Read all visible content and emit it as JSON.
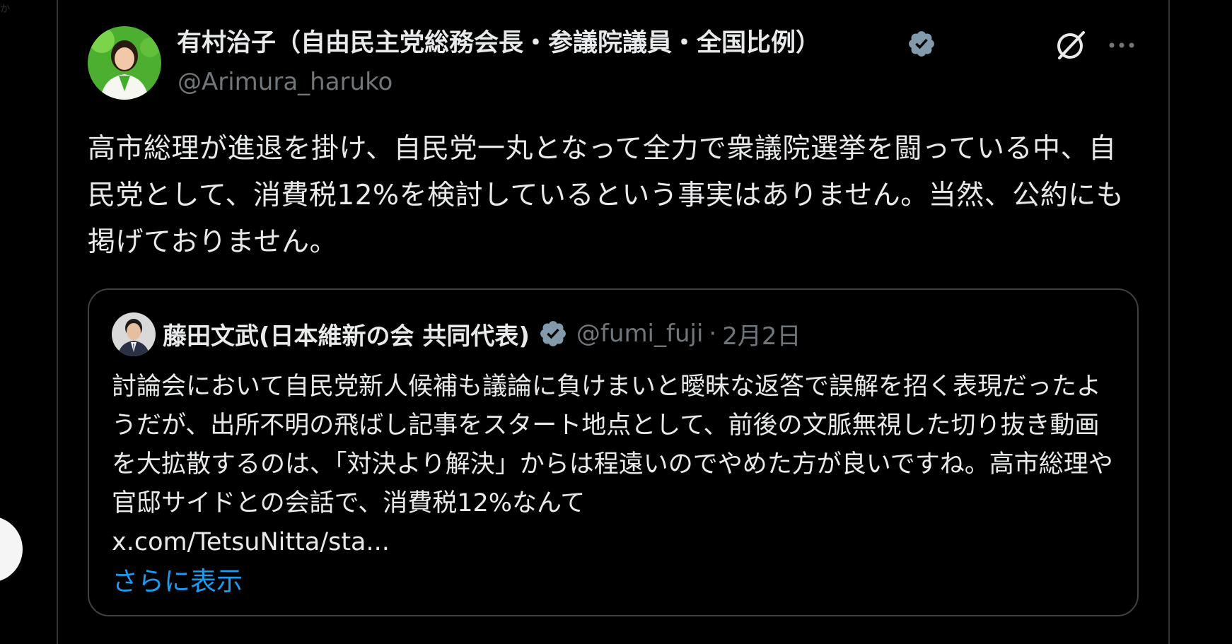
{
  "post": {
    "author_name": "有村治子（自由民主党総務会長・参議院議員・全国比例）",
    "author_handle": "@Arimura_haruko",
    "text": "高市総理が進退を掛け、自民党一丸となって全力で衆議院選挙を闘っている中、自民党として、消費税12%を検討しているという事実はありません。当然、公約にも掲げておりません。"
  },
  "quote": {
    "author_name": "藤田文武(日本維新の会 共同代表)",
    "author_handle": "@fumi_fuji",
    "separator": "·",
    "date": "2月2日",
    "text": "討論会において自民党新人候補も議論に負けまいと曖昧な返答で誤解を招く表現だったようだが、出所不明の飛ばし記事をスタート地点として、前後の文脈無視した切り抜き動画を大拡散するのは、「対決より解決」からは程遠いのでやめた方が良いですね。高市総理や官邸サイドとの会話で、消費税12%なんて",
    "link": "x.com/TetsuNitta/sta...",
    "show_more_label": "さらに表示"
  },
  "icons": {
    "verified": "verified-badge-icon",
    "grok": "grok-icon",
    "more": "more-options-icon"
  },
  "colors": {
    "background": "#000000",
    "text_primary": "#e7e9ea",
    "text_secondary": "#71767b",
    "link": "#1d9bf0",
    "border": "#2f3336",
    "verified": "#829aab"
  }
}
